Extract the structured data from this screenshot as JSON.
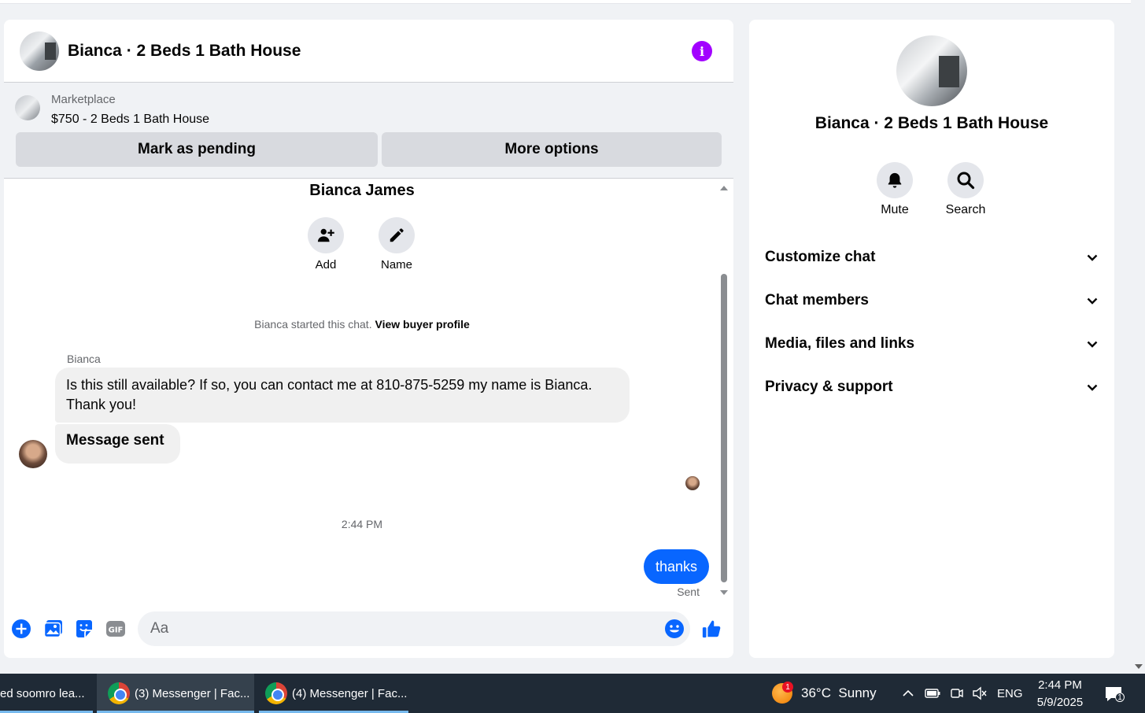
{
  "chat": {
    "title": "Bianca · 2 Beds 1 Bath House",
    "marketplace_label": "Marketplace",
    "listing": "$750 - 2 Beds 1 Bath House",
    "mark_pending": "Mark as pending",
    "more_options": "More options",
    "peer_name": "Bianca James",
    "add_label": "Add",
    "name_label": "Name",
    "system_text": "Bianca started this chat.",
    "view_buyer": "View buyer profile",
    "sender": "Bianca",
    "message_1": "Is this still available? If so, you can contact me at 810-875-5259 my name is Bianca. Thank you!",
    "message_2": "Message sent",
    "timestamp": "2:44 PM",
    "message_out": "thanks",
    "sent_status": "Sent",
    "input_placeholder": "Aa",
    "accent": "#0866ff",
    "info_color": "#a200ff"
  },
  "info_panel": {
    "name": "Bianca · 2 Beds 1 Bath House",
    "mute_label": "Mute",
    "search_label": "Search",
    "sections": [
      "Customize chat",
      "Chat members",
      "Media, files and links",
      "Privacy & support"
    ]
  },
  "taskbar": {
    "tasks": [
      "ed soomro lea...",
      "(3) Messenger | Fac...",
      "(4) Messenger | Fac..."
    ],
    "weather_badge": "1",
    "weather": "36°C  Sunny",
    "language": "ENG",
    "time": "2:44 PM",
    "date": "5/9/2025",
    "notif_count": "1"
  }
}
